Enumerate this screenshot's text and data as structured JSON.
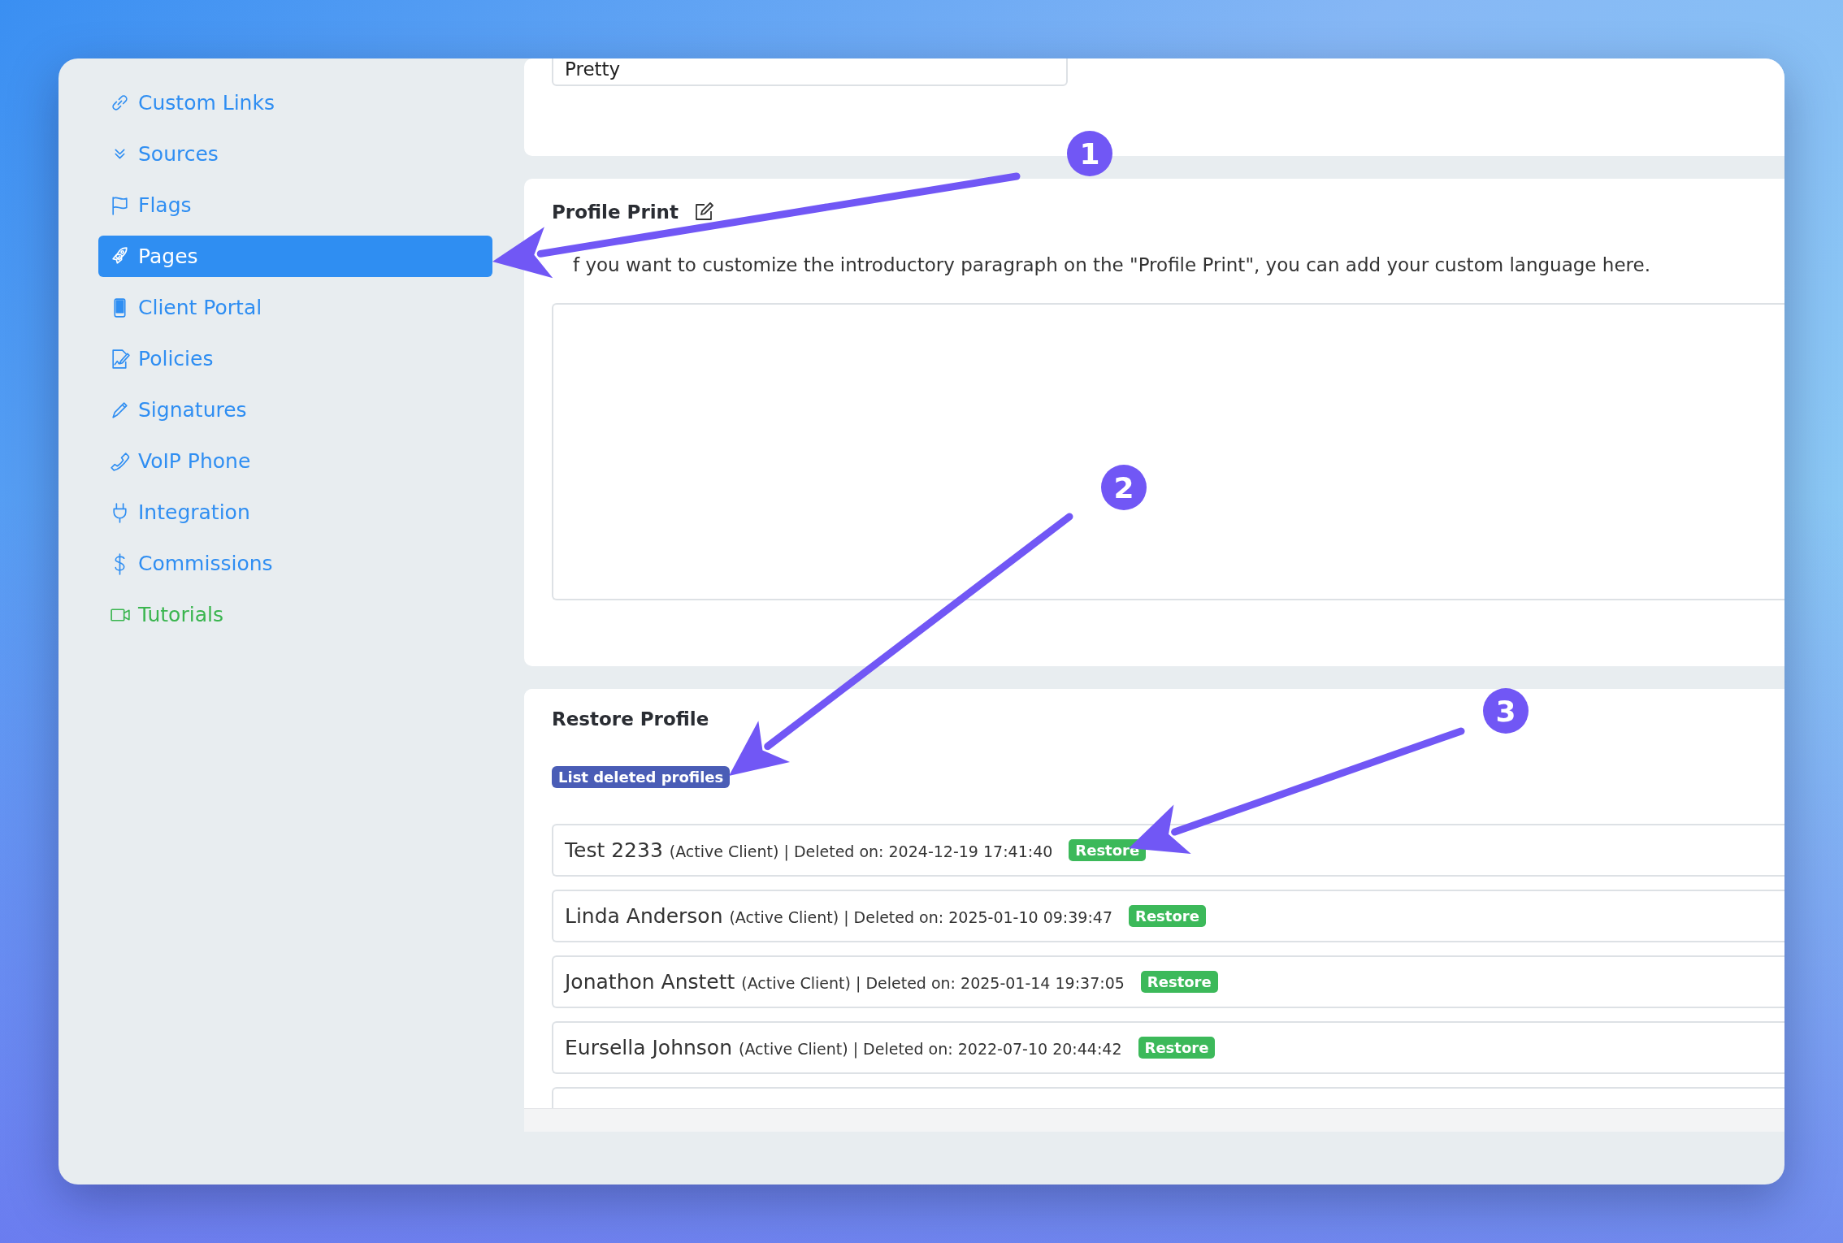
{
  "sidebar": {
    "items": [
      {
        "label": "Custom Links",
        "kind": "nav",
        "selected": false
      },
      {
        "label": "Sources",
        "kind": "nav",
        "selected": false
      },
      {
        "label": "Flags",
        "kind": "nav",
        "selected": false
      },
      {
        "label": "Pages",
        "kind": "nav",
        "selected": true
      },
      {
        "label": "Client Portal",
        "kind": "nav",
        "selected": false
      },
      {
        "label": "Policies",
        "kind": "nav",
        "selected": false
      },
      {
        "label": "Signatures",
        "kind": "nav",
        "selected": false
      },
      {
        "label": "VoIP Phone",
        "kind": "nav",
        "selected": false
      },
      {
        "label": "Integration",
        "kind": "nav",
        "selected": false
      },
      {
        "label": "Commissions",
        "kind": "nav",
        "selected": false
      },
      {
        "label": "Tutorials",
        "kind": "help",
        "selected": false
      }
    ]
  },
  "name_format_panel": {
    "field": {
      "value": "Pretty"
    }
  },
  "profile_print": {
    "title": "Profile Print",
    "description": "f you want to customize the introductory paragraph on the \"Profile Print\", you can add your custom language here."
  },
  "restore_profile": {
    "title": "Restore Profile",
    "list_button": "List deleted profiles",
    "rows": [
      {
        "name": "Test 2233",
        "detail": "(Active Client) | Deleted on: 2024-12-19 17:41:40",
        "action": "Restore"
      },
      {
        "name": "Linda Anderson",
        "detail": "(Active Client) | Deleted on: 2025-01-10 09:39:47",
        "action": "Restore"
      },
      {
        "name": "Jonathon Anstett",
        "detail": "(Active Client) | Deleted on: 2025-01-14 19:37:05",
        "action": "Restore"
      },
      {
        "name": "Eursella Johnson",
        "detail": "(Active Client) | Deleted on: 2022-07-10 20:44:42",
        "action": "Restore"
      }
    ]
  },
  "annotations": [
    {
      "number": "1"
    },
    {
      "number": "2"
    },
    {
      "number": "3"
    }
  ]
}
